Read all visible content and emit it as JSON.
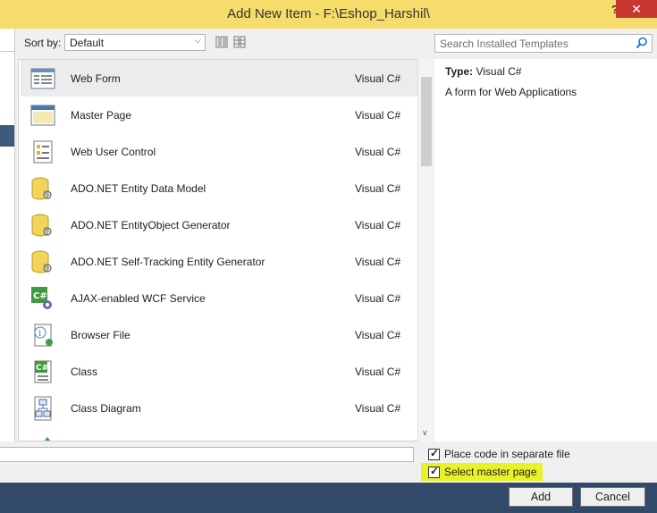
{
  "window": {
    "title": "Add New Item - F:\\Eshop_Harshil\\",
    "help": "?",
    "close": "✕"
  },
  "toolbar": {
    "sort_label": "Sort by:",
    "sort_value": "Default",
    "search_placeholder": "Search Installed Templates"
  },
  "items": [
    {
      "name": "Web Form",
      "lang": "Visual C#",
      "icon": "web-form-icon",
      "selected": true
    },
    {
      "name": "Master Page",
      "lang": "Visual C#",
      "icon": "master-page-icon"
    },
    {
      "name": "Web User Control",
      "lang": "Visual C#",
      "icon": "user-control-icon"
    },
    {
      "name": "ADO.NET Entity Data Model",
      "lang": "Visual C#",
      "icon": "database-icon"
    },
    {
      "name": "ADO.NET EntityObject Generator",
      "lang": "Visual C#",
      "icon": "database-icon"
    },
    {
      "name": "ADO.NET Self-Tracking Entity Generator",
      "lang": "Visual C#",
      "icon": "database-icon"
    },
    {
      "name": "AJAX-enabled WCF Service",
      "lang": "Visual C#",
      "icon": "wcf-service-icon"
    },
    {
      "name": "Browser File",
      "lang": "Visual C#",
      "icon": "browser-file-icon"
    },
    {
      "name": "Class",
      "lang": "Visual C#",
      "icon": "class-icon"
    },
    {
      "name": "Class Diagram",
      "lang": "Visual C#",
      "icon": "class-diagram-icon"
    }
  ],
  "details": {
    "type_label": "Type:",
    "type_value": "Visual C#",
    "description": "A form for Web Applications"
  },
  "options": {
    "separate_file": "Place code in separate file",
    "master_page": "Select master page"
  },
  "buttons": {
    "add": "Add",
    "cancel": "Cancel"
  }
}
